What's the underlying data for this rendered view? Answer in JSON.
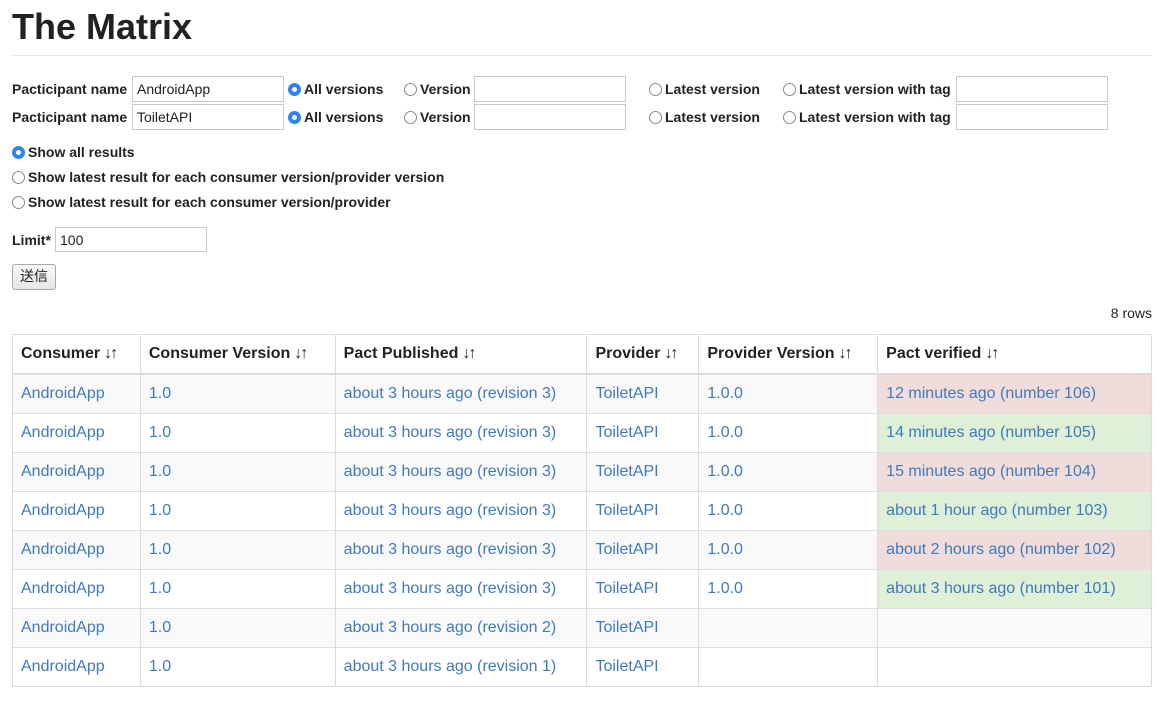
{
  "page": {
    "title": "The Matrix"
  },
  "form": {
    "participants": [
      {
        "label": "Pacticipant name",
        "name_value": "AndroidApp",
        "all_versions_label": "All versions",
        "version_label": "Version",
        "version_value": "",
        "latest_label": "Latest version",
        "latest_tag_label": "Latest version with tag",
        "tag_value": "",
        "selected": "all"
      },
      {
        "label": "Pacticipant name",
        "name_value": "ToiletAPI",
        "all_versions_label": "All versions",
        "version_label": "Version",
        "version_value": "",
        "latest_label": "Latest version",
        "latest_tag_label": "Latest version with tag",
        "tag_value": "",
        "selected": "all"
      }
    ],
    "result_options": [
      {
        "label": "Show all results",
        "selected": true
      },
      {
        "label": "Show latest result for each consumer version/provider version",
        "selected": false
      },
      {
        "label": "Show latest result for each consumer version/provider",
        "selected": false
      }
    ],
    "limit_label": "Limit*",
    "limit_value": "100",
    "submit_label": "送信"
  },
  "rows_count": "8 rows",
  "table": {
    "sort_icon": "↓↑",
    "headers": [
      "Consumer",
      "Consumer Version",
      "Pact Published",
      "Provider",
      "Provider Version",
      "Pact verified"
    ],
    "rows": [
      {
        "consumer": "AndroidApp",
        "consumer_version": "1.0",
        "pact_published": "about 3 hours ago (revision 3)",
        "provider": "ToiletAPI",
        "provider_version": "1.0.0",
        "pact_verified": "12 minutes ago (number 106)",
        "status": "fail"
      },
      {
        "consumer": "AndroidApp",
        "consumer_version": "1.0",
        "pact_published": "about 3 hours ago (revision 3)",
        "provider": "ToiletAPI",
        "provider_version": "1.0.0",
        "pact_verified": "14 minutes ago (number 105)",
        "status": "pass"
      },
      {
        "consumer": "AndroidApp",
        "consumer_version": "1.0",
        "pact_published": "about 3 hours ago (revision 3)",
        "provider": "ToiletAPI",
        "provider_version": "1.0.0",
        "pact_verified": "15 minutes ago (number 104)",
        "status": "fail"
      },
      {
        "consumer": "AndroidApp",
        "consumer_version": "1.0",
        "pact_published": "about 3 hours ago (revision 3)",
        "provider": "ToiletAPI",
        "provider_version": "1.0.0",
        "pact_verified": "about 1 hour ago (number 103)",
        "status": "pass"
      },
      {
        "consumer": "AndroidApp",
        "consumer_version": "1.0",
        "pact_published": "about 3 hours ago (revision 3)",
        "provider": "ToiletAPI",
        "provider_version": "1.0.0",
        "pact_verified": "about 2 hours ago (number 102)",
        "status": "fail"
      },
      {
        "consumer": "AndroidApp",
        "consumer_version": "1.0",
        "pact_published": "about 3 hours ago (revision 3)",
        "provider": "ToiletAPI",
        "provider_version": "1.0.0",
        "pact_verified": "about 3 hours ago (number 101)",
        "status": "pass"
      },
      {
        "consumer": "AndroidApp",
        "consumer_version": "1.0",
        "pact_published": "about 3 hours ago (revision 2)",
        "provider": "ToiletAPI",
        "provider_version": "",
        "pact_verified": "",
        "status": "none"
      },
      {
        "consumer": "AndroidApp",
        "consumer_version": "1.0",
        "pact_published": "about 3 hours ago (revision 1)",
        "provider": "ToiletAPI",
        "provider_version": "",
        "pact_verified": "",
        "status": "none"
      }
    ]
  },
  "colors": {
    "link": "#3f7ab9",
    "fail_bg": "#f1dcdc",
    "pass_bg": "#dff0d8",
    "radio_selected": "#2f82f7"
  }
}
